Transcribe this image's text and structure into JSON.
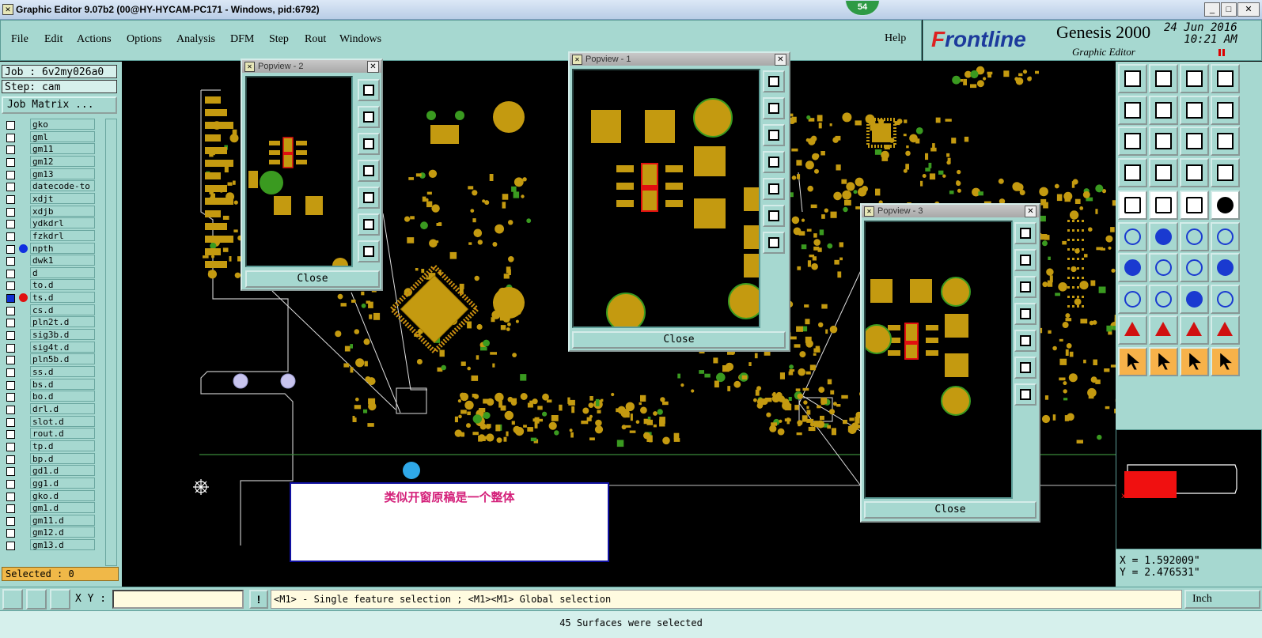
{
  "window": {
    "title": "Graphic Editor 9.07b2 (00@HY-HYCAM-PC171 - Windows, pid:6792)",
    "badge": "54"
  },
  "menu": {
    "items": [
      "File",
      "Edit",
      "Actions",
      "Options",
      "Analysis",
      "DFM",
      "Step",
      "Rout",
      "Windows"
    ],
    "help": "Help"
  },
  "logo": {
    "brand_f": "F",
    "brand_rest": "rontline",
    "product": "Genesis 2000",
    "subtitle": "Graphic Editor",
    "date": "24 Jun 2016",
    "time": "10:21 AM"
  },
  "job": {
    "job_label": "Job : 6v2my026a0",
    "step_label": "Step: cam",
    "matrix_button": "Job Matrix ..."
  },
  "layers": [
    {
      "name": "gko",
      "checked": false,
      "dot": "",
      "arrow": ""
    },
    {
      "name": "gml",
      "checked": false,
      "dot": "",
      "arrow": ""
    },
    {
      "name": "gm11",
      "checked": false,
      "dot": "",
      "arrow": ""
    },
    {
      "name": "gm12",
      "checked": false,
      "dot": "",
      "arrow": ""
    },
    {
      "name": "gm13",
      "checked": false,
      "dot": "",
      "arrow": ""
    },
    {
      "name": "datecode-to",
      "checked": false,
      "dot": "",
      "arrow": ""
    },
    {
      "name": "xdjt",
      "checked": false,
      "dot": "",
      "arrow": ""
    },
    {
      "name": "xdjb",
      "checked": false,
      "dot": "",
      "arrow": ""
    },
    {
      "name": "ydkdrl",
      "checked": false,
      "dot": "",
      "arrow": ""
    },
    {
      "name": "fzkdrl",
      "checked": false,
      "dot": "",
      "arrow": ""
    },
    {
      "name": "npth",
      "checked": false,
      "dot": "#1030e0",
      "arrow": ""
    },
    {
      "name": "dwk1",
      "checked": false,
      "dot": "",
      "arrow": ""
    },
    {
      "name": "d",
      "checked": false,
      "dot": "",
      "arrow": ""
    },
    {
      "name": "to.d",
      "checked": false,
      "dot": "",
      "arrow": "⬋"
    },
    {
      "name": "ts.d",
      "checked": true,
      "dot": "#e01010",
      "arrow": "▥"
    },
    {
      "name": "cs.d",
      "checked": false,
      "dot": "",
      "arrow": "⬋"
    },
    {
      "name": "pln2t.d",
      "checked": false,
      "dot": "",
      "arrow": "⬋"
    },
    {
      "name": "sig3b.d",
      "checked": false,
      "dot": "",
      "arrow": "⬋"
    },
    {
      "name": "sig4t.d",
      "checked": false,
      "dot": "",
      "arrow": "⬋"
    },
    {
      "name": "pln5b.d",
      "checked": false,
      "dot": "",
      "arrow": "⬋"
    },
    {
      "name": "ss.d",
      "checked": false,
      "dot": "",
      "arrow": "⬋"
    },
    {
      "name": "bs.d",
      "checked": false,
      "dot": "",
      "arrow": ""
    },
    {
      "name": "bo.d",
      "checked": false,
      "dot": "",
      "arrow": "⬋"
    },
    {
      "name": "drl.d",
      "checked": false,
      "dot": "",
      "arrow": ""
    },
    {
      "name": "slot.d",
      "checked": false,
      "dot": "",
      "arrow": ""
    },
    {
      "name": "rout.d",
      "checked": false,
      "dot": "",
      "arrow": ""
    },
    {
      "name": "tp.d",
      "checked": false,
      "dot": "",
      "arrow": ""
    },
    {
      "name": "bp.d",
      "checked": false,
      "dot": "",
      "arrow": ""
    },
    {
      "name": "gd1.d",
      "checked": false,
      "dot": "",
      "arrow": "⬋"
    },
    {
      "name": "gg1.d",
      "checked": false,
      "dot": "",
      "arrow": ""
    },
    {
      "name": "gko.d",
      "checked": false,
      "dot": "",
      "arrow": ""
    },
    {
      "name": "gm1.d",
      "checked": false,
      "dot": "",
      "arrow": ""
    },
    {
      "name": "gm11.d",
      "checked": false,
      "dot": "",
      "arrow": ""
    },
    {
      "name": "gm12.d",
      "checked": false,
      "dot": "",
      "arrow": ""
    },
    {
      "name": "gm13.d",
      "checked": false,
      "dot": "",
      "arrow": ""
    }
  ],
  "selected": "Selected : 0",
  "popviews": [
    {
      "title": "Popview - 2",
      "close": "Close"
    },
    {
      "title": "Popview - 1",
      "close": "Close"
    },
    {
      "title": "Popview - 3",
      "close": "Close"
    }
  ],
  "note": "类似开窗原稿是一个整体",
  "coords": {
    "x": "X =  1.592009\"",
    "y": "Y =  2.476531\""
  },
  "bottom": {
    "xy_label": "X Y :",
    "xy_value": "",
    "prompt": "<M1> - Single feature selection ; <M1><M1> Global selection",
    "units": "Inch",
    "status": "45 Surfaces were selected"
  },
  "colors": {
    "panel": "#a6d8d0",
    "pad": "#c49a10",
    "pad_green": "#3a9a20",
    "highlight": "#e01010",
    "board_outline": "#c0c0c0"
  }
}
